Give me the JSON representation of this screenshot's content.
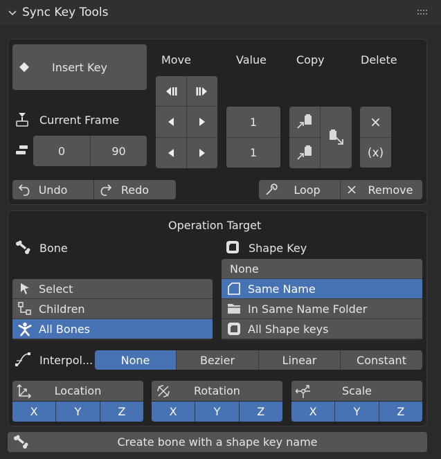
{
  "panel": {
    "title": "Sync Key Tools"
  },
  "keys": {
    "insert_key": "Insert Key",
    "move_header": "Move",
    "value_header": "Value",
    "copy_header": "Copy",
    "delete_header": "Delete",
    "current_frame_label": "Current Frame",
    "frame_start": "0",
    "frame_end": "90",
    "value_top": "1",
    "value_bottom": "1",
    "delete_clear": "×",
    "delete_expr": "(x)",
    "undo": "Undo",
    "redo": "Redo",
    "loop": "Loop",
    "remove": "Remove"
  },
  "target": {
    "title": "Operation Target",
    "bone_label": "Bone",
    "shape_key_label": "Shape Key",
    "bone_options": [
      {
        "label": "Select",
        "icon": "cursor-arrow-icon",
        "selected": false
      },
      {
        "label": "Children",
        "icon": "hierarchy-icon",
        "selected": false
      },
      {
        "label": "All Bones",
        "icon": "armature-figure-icon",
        "selected": true
      }
    ],
    "shape_options": [
      {
        "label": "None",
        "icon": "",
        "selected": false
      },
      {
        "label": "Same Name",
        "icon": "shape-key-icon",
        "selected": true
      },
      {
        "label": "In Same Name Folder",
        "icon": "folder-icon",
        "selected": false
      },
      {
        "label": "All Shape keys",
        "icon": "shape-keys-icon",
        "selected": false
      }
    ],
    "interpolation_label": "Interpol...",
    "interpolation_options": [
      "None",
      "Bezier",
      "Linear",
      "Constant"
    ],
    "interpolation_selected": "None",
    "location_label": "Location",
    "rotation_label": "Rotation",
    "scale_label": "Scale",
    "axes": [
      "X",
      "Y",
      "Z"
    ]
  },
  "footer": {
    "create_bone": "Create bone with a shape key name"
  },
  "colors": {
    "accent": "#4772b3",
    "button": "#545454",
    "panel": "#232323",
    "background": "#2a2a2a"
  }
}
